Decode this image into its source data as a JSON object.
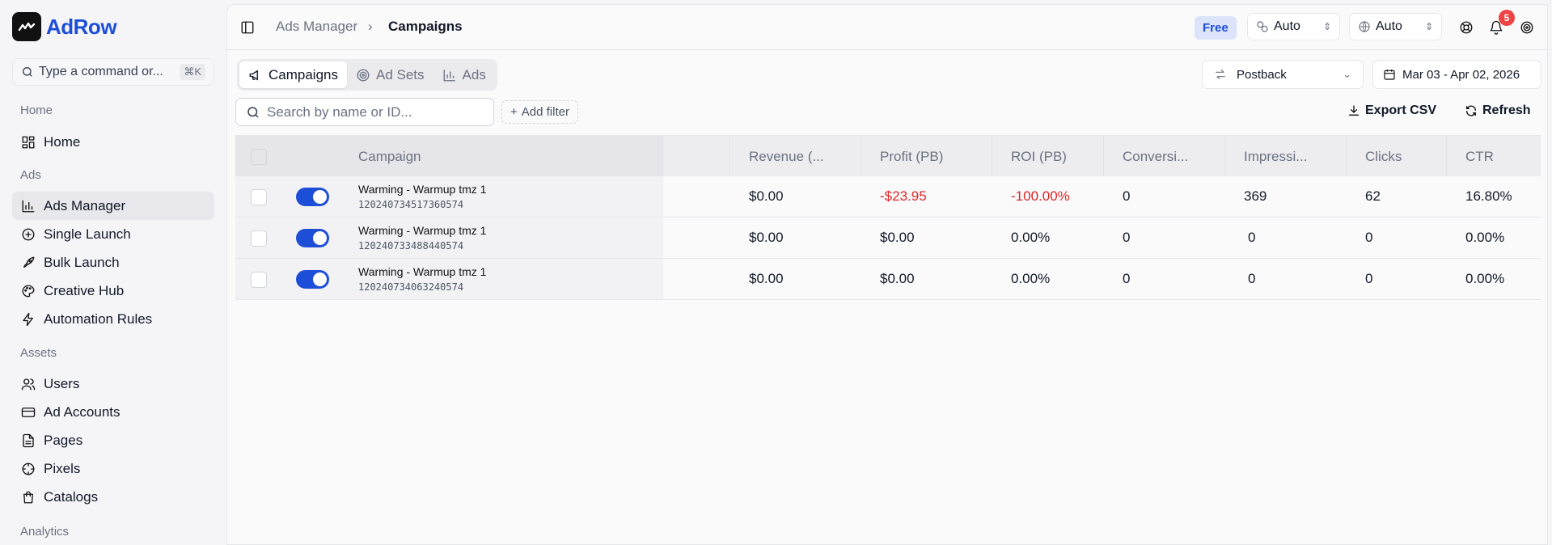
{
  "app": {
    "name": "AdRow"
  },
  "command": {
    "placeholder": "Type a command or...",
    "shortcut": "⌘K"
  },
  "sidebar": {
    "sections": [
      {
        "title": "Home",
        "items": [
          {
            "label": "Home",
            "icon": "grid-icon"
          }
        ]
      },
      {
        "title": "Ads",
        "items": [
          {
            "label": "Ads Manager",
            "icon": "bar-chart-icon",
            "active": true
          },
          {
            "label": "Single Launch",
            "icon": "plus-circle-icon"
          },
          {
            "label": "Bulk Launch",
            "icon": "rocket-icon"
          },
          {
            "label": "Creative Hub",
            "icon": "palette-icon"
          },
          {
            "label": "Automation Rules",
            "icon": "zap-icon"
          }
        ]
      },
      {
        "title": "Assets",
        "items": [
          {
            "label": "Users",
            "icon": "users-icon"
          },
          {
            "label": "Ad Accounts",
            "icon": "credit-card-icon"
          },
          {
            "label": "Pages",
            "icon": "file-icon"
          },
          {
            "label": "Pixels",
            "icon": "pixel-icon"
          },
          {
            "label": "Catalogs",
            "icon": "shopping-bag-icon"
          }
        ]
      },
      {
        "title": "Analytics",
        "items": []
      }
    ]
  },
  "header": {
    "breadcrumb": [
      "Ads Manager",
      "Campaigns"
    ],
    "plan_badge": "Free",
    "selector1": "Auto",
    "selector2": "Auto",
    "notification_count": "5"
  },
  "tabs": [
    {
      "label": "Campaigns",
      "icon": "megaphone-icon",
      "active": true
    },
    {
      "label": "Ad Sets",
      "icon": "target-icon"
    },
    {
      "label": "Ads",
      "icon": "bar-chart-icon"
    }
  ],
  "attribution": "Postback",
  "date_range": "Mar 03 - Apr 02, 2026",
  "search": {
    "placeholder": "Search by name or ID..."
  },
  "add_filter": "Add filter",
  "export_label": "Export CSV",
  "refresh_label": "Refresh",
  "table": {
    "columns": [
      "Campaign",
      "Revenue (...",
      "Profit (PB)",
      "ROI (PB)",
      "Conversi...",
      "Impressi...",
      "Clicks",
      "CTR"
    ],
    "rows": [
      {
        "name": "Warming - Warmup tmz 1",
        "id": "120240734517360574",
        "enabled": true,
        "revenue": "$0.00",
        "profit": "-$23.95",
        "roi": "-100.00%",
        "conversions": "0",
        "impressions": "369",
        "clicks": "62",
        "ctr": "16.80%"
      },
      {
        "name": "Warming - Warmup tmz 1",
        "id": "120240733488440574",
        "enabled": true,
        "revenue": "$0.00",
        "profit": "$0.00",
        "roi": "0.00%",
        "conversions": "0",
        "impressions": "0",
        "clicks": "0",
        "ctr": "0.00%"
      },
      {
        "name": "Warming - Warmup tmz 1",
        "id": "120240734063240574",
        "enabled": true,
        "revenue": "$0.00",
        "profit": "$0.00",
        "roi": "0.00%",
        "conversions": "0",
        "impressions": "0",
        "clicks": "0",
        "ctr": "0.00%"
      }
    ]
  },
  "colors": {
    "accent": "#1d4ed8",
    "negative": "#dc2626",
    "badge": "#ef4444"
  }
}
